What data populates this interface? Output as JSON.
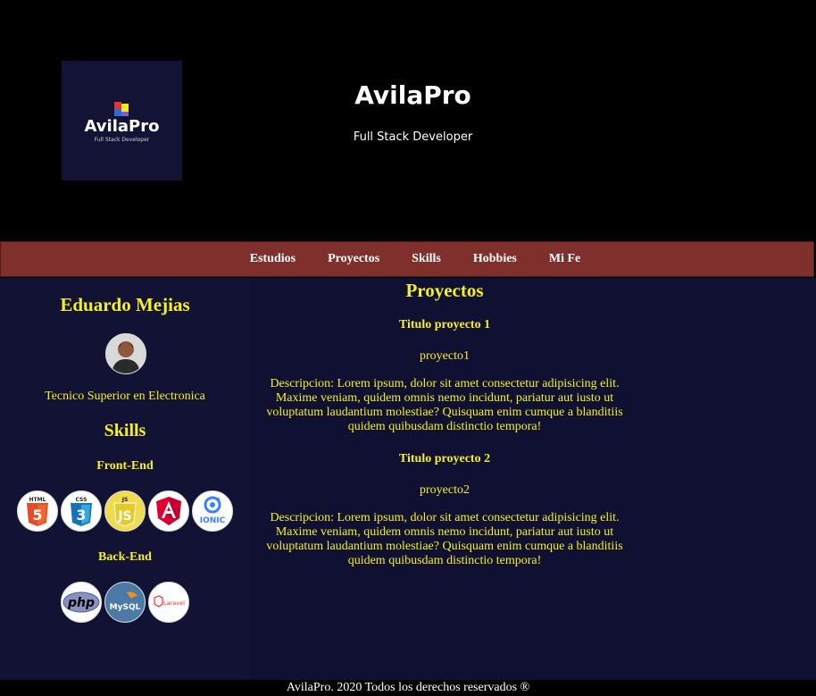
{
  "header": {
    "logo_text": "AvilaPro",
    "logo_subtext": "Full Stack Developer",
    "title": "AvilaPro",
    "subtitle": "Full Stack Developer"
  },
  "nav": {
    "items": [
      {
        "label": "Estudios"
      },
      {
        "label": "Proyectos"
      },
      {
        "label": "Skills"
      },
      {
        "label": "Hobbies"
      },
      {
        "label": "Mi Fe"
      }
    ]
  },
  "sidebar": {
    "name": "Eduardo Mejias",
    "role": "Tecnico Superior en Electronica",
    "skills_heading": "Skills",
    "front_heading": "Front-End",
    "front_icons": [
      "html5-icon",
      "css3-icon",
      "javascript-icon",
      "angular-icon",
      "ionic-icon"
    ],
    "front_labels": {
      "html": "HTML",
      "css": "CSS",
      "js": "JS",
      "ionic": "IONIC"
    },
    "back_heading": "Back-End",
    "back_icons": [
      "php-icon",
      "mysql-icon",
      "laravel-icon"
    ],
    "back_labels": {
      "php": "php",
      "mysql": "MySQL",
      "laravel": "Laravel"
    }
  },
  "main": {
    "heading": "Proyectos",
    "projects": [
      {
        "title": "Titulo proyecto 1",
        "name": "proyecto1",
        "description": "Descripcion: Lorem ipsum, dolor sit amet consectetur adipisicing elit. Maxime veniam, quidem omnis nemo incidunt, pariatur aut iusto ut voluptatum laudantium molestiae? Quisquam enim cumque a blanditiis quidem quibusdam distinctio tempora!"
      },
      {
        "title": "Titulo proyecto 2",
        "name": "proyecto2",
        "description": "Descripcion: Lorem ipsum, dolor sit amet consectetur adipisicing elit. Maxime veniam, quidem omnis nemo incidunt, pariatur aut iusto ut voluptatum laudantium molestiae? Quisquam enim cumque a blanditiis quidem quibusdam distinctio tempora!"
      }
    ]
  },
  "footer": {
    "text": "AvilaPro. 2020 Todos los derechos reservados ®"
  },
  "colors": {
    "background": "#000000",
    "nav": "#80302c",
    "panel": "#121334",
    "accent_text": "#f5f11e"
  }
}
